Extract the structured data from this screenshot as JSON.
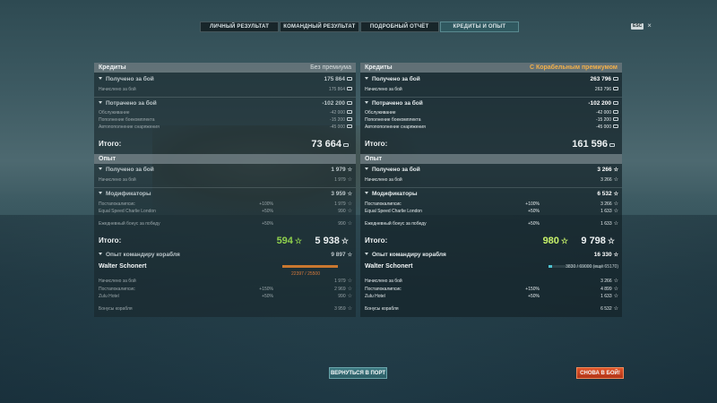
{
  "tabs": [
    {
      "label": "ЛИЧНЫЙ РЕЗУЛЬТАТ"
    },
    {
      "label": "КОМАНДНЫЙ РЕЗУЛЬТАТ"
    },
    {
      "label": "ПОДРОБНЫЙ ОТЧЁТ"
    },
    {
      "label": "КРЕДИТЫ И ОПЫТ"
    }
  ],
  "ui": {
    "key_badge": "ESC",
    "close": "×"
  },
  "left": {
    "credits_header": "Кредиты",
    "credits_header_right": "Без премиума",
    "received": {
      "label": "Получено за бой",
      "value": "175 864"
    },
    "received_rows": [
      {
        "label": "Начислено за бой",
        "value": "175 864"
      }
    ],
    "spent": {
      "label": "Потрачено за бой",
      "value": "-102 200"
    },
    "spent_rows": [
      {
        "label": "Обслуживание",
        "value": "-42 000"
      },
      {
        "label": "Пополнение боекомплекта",
        "value": "-15 200"
      },
      {
        "label": "Автопополнение снаряжения",
        "value": "-45 000"
      }
    ],
    "credits_total": {
      "label": "Итого:",
      "value": "73 664"
    },
    "xp_header": "Опыт",
    "xp_received": {
      "label": "Получено за бой",
      "value": "1 979"
    },
    "xp_received_rows": [
      {
        "label": "Начислено за бой",
        "value": "1 979"
      }
    ],
    "mods": {
      "label": "Модификаторы",
      "value": "3 959"
    },
    "mods_rows": [
      {
        "label": "Постапокалипсис",
        "mult": "+100%",
        "value": "1 979"
      },
      {
        "label": "Equal Speed Charlie London",
        "mult": "+50%",
        "value": "990"
      },
      {
        "label": "Ежедневный бонус за победу",
        "mult": "+50%",
        "value": "990"
      }
    ],
    "xp_total": {
      "label": "Итого:",
      "free": "594",
      "value": "5 938"
    },
    "cmdr_xp": {
      "label": "Опыт командиру корабля",
      "value": "9 897"
    },
    "cmdr_name": "Walter Schonert",
    "cmdr_xp_text": "22397 / 25500",
    "cmdr_rows": [
      {
        "label": "Начислено за бой",
        "mult": "",
        "value": "1 979"
      },
      {
        "label": "Постапокалипсис",
        "mult": "+150%",
        "value": "2 969"
      },
      {
        "label": "Zulu Hotel",
        "mult": "+50%",
        "value": "990"
      }
    ],
    "ship_bonus": {
      "label": "Бонусы корабля",
      "value": "3 959"
    }
  },
  "right": {
    "credits_header": "Кредиты",
    "credits_header_right": "С Корабельным премиумом",
    "received": {
      "label": "Получено за бой",
      "value": "263 796"
    },
    "received_rows": [
      {
        "label": "Начислено за бой",
        "value": "263 796"
      }
    ],
    "spent": {
      "label": "Потрачено за бой",
      "value": "-102 200"
    },
    "spent_rows": [
      {
        "label": "Обслуживание",
        "value": "-42 000"
      },
      {
        "label": "Пополнение боекомплекта",
        "value": "-15 200"
      },
      {
        "label": "Автопополнение снаряжения",
        "value": "-45 000"
      }
    ],
    "credits_total": {
      "label": "Итого:",
      "value": "161 596"
    },
    "xp_header": "Опыт",
    "xp_received": {
      "label": "Получено за бой",
      "value": "3 266"
    },
    "xp_received_rows": [
      {
        "label": "Начислено за бой",
        "value": "3 266"
      }
    ],
    "mods": {
      "label": "Модификаторы",
      "value": "6 532"
    },
    "mods_rows": [
      {
        "label": "Постапокалипсис",
        "mult": "+100%",
        "value": "3 266"
      },
      {
        "label": "Equal Speed Charlie London",
        "mult": "+50%",
        "value": "1 633"
      },
      {
        "label": "Ежедневный бонус за победу",
        "mult": "+50%",
        "value": "1 633"
      }
    ],
    "xp_total": {
      "label": "Итого:",
      "free": "980",
      "value": "9 798"
    },
    "cmdr_xp": {
      "label": "Опыт командиру корабля",
      "value": "16 330"
    },
    "cmdr_name": "Walter Schonert",
    "cmdr_xp_text": "3830 / 69000 (ещё 65170)",
    "cmdr_rows": [
      {
        "label": "Начислено за бой",
        "mult": "",
        "value": "3 266"
      },
      {
        "label": "Постапокалипсис",
        "mult": "+150%",
        "value": "4 899"
      },
      {
        "label": "Zulu Hotel",
        "mult": "+50%",
        "value": "1 633"
      }
    ],
    "ship_bonus": {
      "label": "Бонусы корабля",
      "value": "6 532"
    }
  },
  "buttons": {
    "back": "ВЕРНУТЬСЯ В ПОРТ",
    "again": "СНОВА В БОЙ!"
  },
  "colors": {
    "accent_orange": "#f3b04a",
    "free_xp_green": "#8fd04d",
    "battle_button": "#e0562a",
    "port_button": "#3c7a82"
  }
}
